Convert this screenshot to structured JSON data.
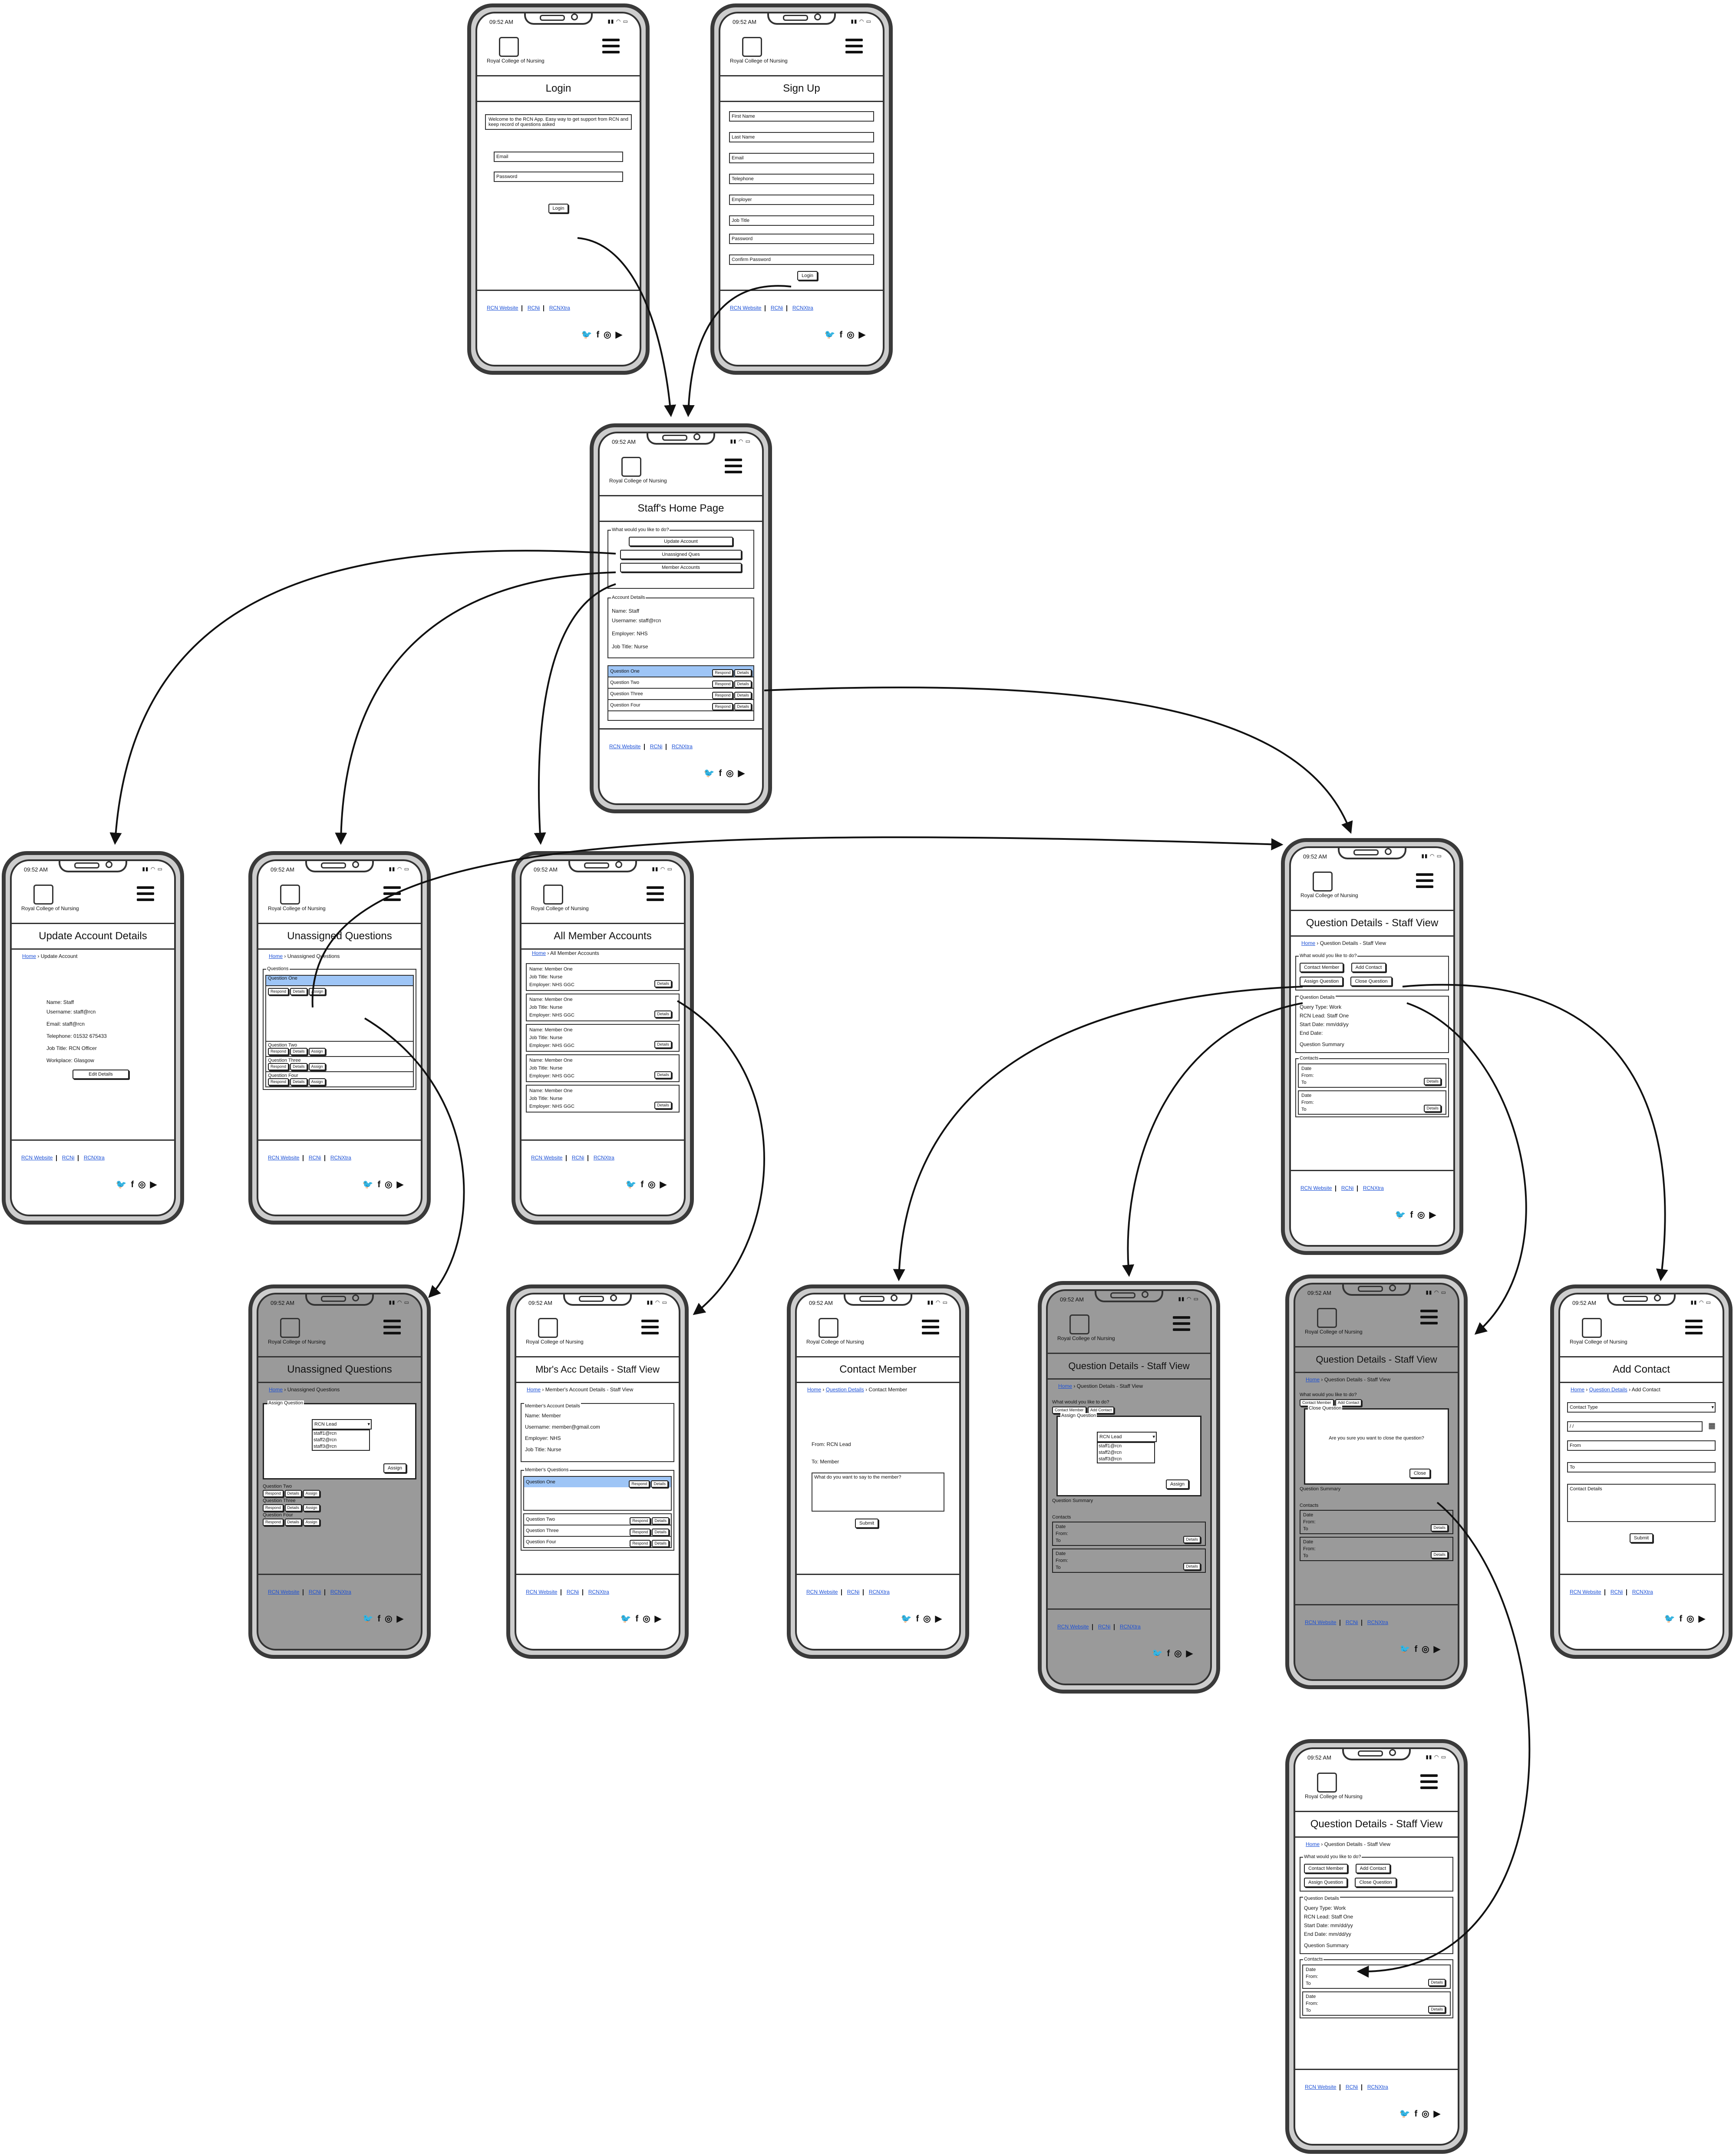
{
  "common": {
    "time": "09:52 AM",
    "logo_text": "Royal College of Nursing",
    "footer_links": [
      "RCN Website",
      "RCNi",
      "RCNXtra"
    ]
  },
  "login": {
    "title": "Login",
    "welcome": "Welcome to the RCN App. Easy way to get support from RCN and keep record of questions asked",
    "email_placeholder": "Email",
    "password_placeholder": "Password",
    "login_button": "Login"
  },
  "signup": {
    "title": "Sign Up",
    "fields": [
      "First Name",
      "Last Name",
      "Email",
      "Telephone",
      "Employer",
      "Job Title",
      "Password",
      "Confirm Password"
    ],
    "login_button": "Login"
  },
  "home": {
    "title": "Staff's Home Page",
    "group_label": "What would you like to do?",
    "buttons": [
      "Update Account",
      "Unassigned Ques",
      "Member Accounts"
    ],
    "account_label": "Account Details",
    "account": [
      "Name: Staff",
      "Username: staff@rcn",
      "Employer: NHS",
      "Job Title: Nurse"
    ],
    "questions": [
      "Question One",
      "Question Two",
      "Question Three",
      "Question Four"
    ],
    "q_actions": [
      "Respond",
      "Details"
    ]
  },
  "update_account": {
    "title": "Update Account Details",
    "crumb_home": "Home",
    "crumb_current": "Update Account",
    "lines": [
      "Name: Staff",
      "Username: staff@rcn",
      "Email: staff@rcn",
      "Telephone: 01532 675433",
      "Job Title: RCN Officer",
      "Workplace: Glasgow"
    ],
    "edit_button": "Edit Details"
  },
  "unassigned": {
    "title": "Unassigned Questions",
    "crumb_home": "Home",
    "crumb_current": "Unassigned Questions",
    "group_label": "Questions",
    "questions": [
      "Question One",
      "Question Two",
      "Question Three",
      "Question Four"
    ],
    "actions": [
      "Respond",
      "Details",
      "Assign"
    ]
  },
  "members": {
    "title": "All Member Accounts",
    "crumb_home": "Home",
    "crumb_current": "All Member Accounts",
    "cards": [
      [
        "Name: Member One",
        "Job Title: Nurse",
        "Employer: NHS GGC"
      ],
      [
        "Name: Member One",
        "Job Title: Nurse",
        "Employer: NHS GGC"
      ],
      [
        "Name: Member One",
        "Job Title: Nurse",
        "Employer: NHS GGC"
      ],
      [
        "Name: Member One",
        "Job Title: Nurse",
        "Employer: NHS GGC"
      ],
      [
        "Name: Member One",
        "Job Title: Nurse",
        "Employer: NHS GGC"
      ]
    ],
    "details_button": "Details"
  },
  "question_details": {
    "title": "Question Details - Staff View",
    "crumb_home": "Home",
    "crumb_current": "Question Details - Staff View",
    "group_label": "What would you like to do?",
    "buttons": [
      "Contact Member",
      "Add Contact",
      "Assign Question",
      "Close Question"
    ],
    "details_label": "Question Details",
    "details": [
      "Query Type: Work",
      "RCN Lead: Staff One",
      "Start Date: mm/dd/yy",
      "End Date:",
      "Question Summary"
    ],
    "details_end": [
      "Query Type: Work",
      "RCN Lead: Staff One",
      "Start Date: mm/dd/yy",
      "End Date: mm/dd/yy",
      "Question Summary"
    ],
    "contacts_label": "Contacts",
    "contact_lines": [
      "Date",
      "From:",
      "To"
    ],
    "details_button": "Details"
  },
  "assign_modal": {
    "label": "Assign Question",
    "select_value": "RCN Lead",
    "options": [
      "staff1@rcn",
      "staff2@rcn",
      "staff3@rcn"
    ],
    "assign_button": "Assign"
  },
  "mbr_details": {
    "title": "Mbr's Acc Details - Staff View",
    "crumb_home": "Home",
    "crumb_current": "Member's Account Details - Staff View",
    "account_label": "Member's Account Details",
    "account": [
      "Name: Member",
      "Username: member@gmail.com",
      "Employer: NHS",
      "Job Title: Nurse"
    ],
    "questions_label": "Member's Questions",
    "questions": [
      "Question One",
      "Question Two",
      "Question Three",
      "Question Four"
    ],
    "q_actions": [
      "Respond",
      "Details"
    ]
  },
  "contact_member": {
    "title": "Contact Member",
    "crumb_home": "Home",
    "crumb_mid": "Question Details",
    "crumb_current": "Contact Member",
    "from": "From: RCN Lead",
    "to": "To: Member",
    "message_placeholder": "What do you want to say to the member?",
    "submit": "Submit"
  },
  "close_modal": {
    "label": "Close Question",
    "text": "Are you sure you want to close the question?",
    "button": "Close"
  },
  "add_contact": {
    "title": "Add Contact",
    "crumb_home": "Home",
    "crumb_mid": "Question Details",
    "crumb_current": "Add Contact",
    "type_placeholder": "Contact Type",
    "date_value": "/ /",
    "from": "From",
    "to": "To",
    "details": "Contact Details",
    "submit": "Submit"
  },
  "colors": {
    "selected_row": "#9ec5f6",
    "link": "#1a4fd6",
    "dim": "#9a9a9a"
  }
}
